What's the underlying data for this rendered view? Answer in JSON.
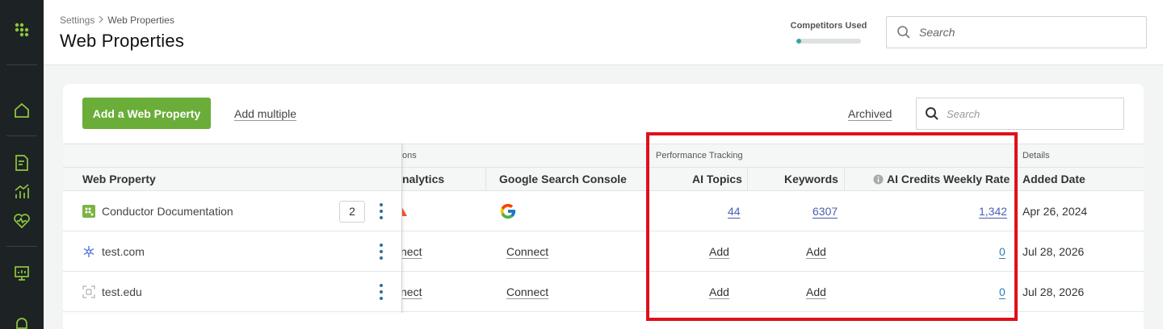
{
  "nav": {
    "icons": [
      "logo-icon",
      "home-icon",
      "report-icon",
      "trend-icon",
      "health-icon",
      "presentation-icon",
      "bell-icon"
    ]
  },
  "header": {
    "breadcrumb_root": "Settings",
    "breadcrumb_current": "Web Properties",
    "title": "Web Properties",
    "competitors_label": "Competitors Used",
    "competitors_fraction": 0.08,
    "search_placeholder": "Search"
  },
  "toolbar": {
    "add_label": "Add a Web Property",
    "add_multiple_label": "Add multiple",
    "archived_label": "Archived",
    "search_placeholder": "Search",
    "add_button_color": "#6aad39"
  },
  "table": {
    "groups": {
      "integrations_partial": "ons",
      "performance": "Performance Tracking",
      "details": "Details"
    },
    "columns": {
      "web_property": "Web Property",
      "analytics_partial": "nalytics",
      "gsc": "Google Search Console",
      "ai_topics": "AI Topics",
      "keywords": "Keywords",
      "ai_credits": "AI Credits Weekly Rate",
      "added_date": "Added Date"
    },
    "rows": [
      {
        "name": "Conductor Documentation",
        "icon": "conductor-logo-icon",
        "count": "2",
        "analytics": "",
        "gsc": "",
        "ai_topics": "44",
        "keywords": "6307",
        "ai_credits": "1,342",
        "added": "Apr 26, 2024"
      },
      {
        "name": "test.com",
        "icon": "snowflake-icon",
        "count": "",
        "analytics": "nect",
        "gsc": "Connect",
        "ai_topics": "Add",
        "keywords": "Add",
        "ai_credits": "0",
        "added": "Jul 28, 2026"
      },
      {
        "name": "test.edu",
        "icon": "placeholder-site-icon",
        "count": "",
        "analytics": "nect",
        "gsc": "Connect",
        "ai_topics": "Add",
        "keywords": "Add",
        "ai_credits": "0",
        "added": "Jul 28, 2026"
      }
    ]
  },
  "highlight_color": "#e0101a"
}
